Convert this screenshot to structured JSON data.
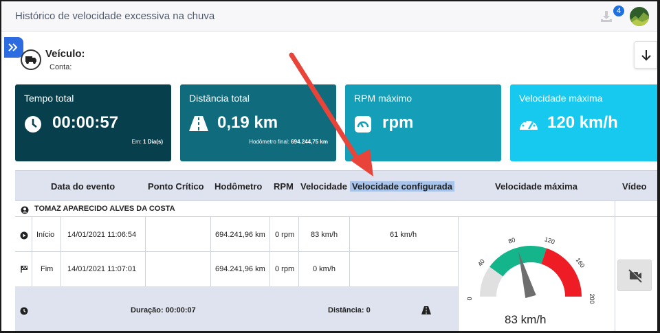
{
  "header": {
    "title": "Histórico de velocidade excessiva na chuva",
    "download_count": "4"
  },
  "vehicle": {
    "label": "Veículo:",
    "account_label": "Conta:"
  },
  "cards": [
    {
      "title": "Tempo total",
      "value": "00:00:57",
      "note_prefix": "Em:",
      "note_value": "1 Dia(s)",
      "color": "#083f4d",
      "icon": "clock-icon"
    },
    {
      "title": "Distância total",
      "value": "0,19 km",
      "note_prefix": "Hodômetro final:",
      "note_value": "694.244,75 km",
      "color": "#106b7d",
      "icon": "road-icon"
    },
    {
      "title": "RPM máximo",
      "value": "rpm",
      "color": "#149eb7",
      "icon": "tachometer-icon"
    },
    {
      "title": "Velocidade máxima",
      "value": "120 km/h",
      "color": "#17c9ee",
      "icon": "speedometer-icon"
    }
  ],
  "table": {
    "headers": {
      "event_date": "Data do evento",
      "critical_point": "Ponto Crítico",
      "odometer": "Hodômetro",
      "rpm": "RPM",
      "speed": "Velocidade",
      "configured_speed": "Velocidade configurada",
      "max_speed": "Velocidade máxima",
      "video": "Vídeo"
    },
    "group_name": "TOMAZ APARECIDO ALVES DA COSTA",
    "rows": [
      {
        "event": "Início",
        "date": "14/01/2021 11:06:54",
        "odometer": "694.241,96 km",
        "rpm": "0 rpm",
        "speed": "83 km/h",
        "configured": "61 km/h",
        "icon": "play-icon"
      },
      {
        "event": "Fim",
        "date": "14/01/2021 11:07:01",
        "odometer": "694.241,96 km",
        "rpm": "0 rpm",
        "speed": "0 km/h",
        "configured": "",
        "icon": "finish-flag-icon"
      }
    ],
    "summary": {
      "duration": "Duração: 00:00:07",
      "distance": "Distância: 0"
    }
  },
  "gauge": {
    "value": 83,
    "min": 0,
    "max": 200,
    "ticks": [
      "0",
      "40",
      "80",
      "120",
      "160",
      "200"
    ],
    "reading": "83 km/h",
    "colors": {
      "low": "#e0e0e0",
      "mid": "#14b58a",
      "high": "#ee1c24",
      "needle": "#6e6e6e"
    }
  },
  "colors": {
    "accent": "#2d6ce0",
    "annotation_arrow": "#e8443a",
    "header_band": "#dfe3ef"
  }
}
